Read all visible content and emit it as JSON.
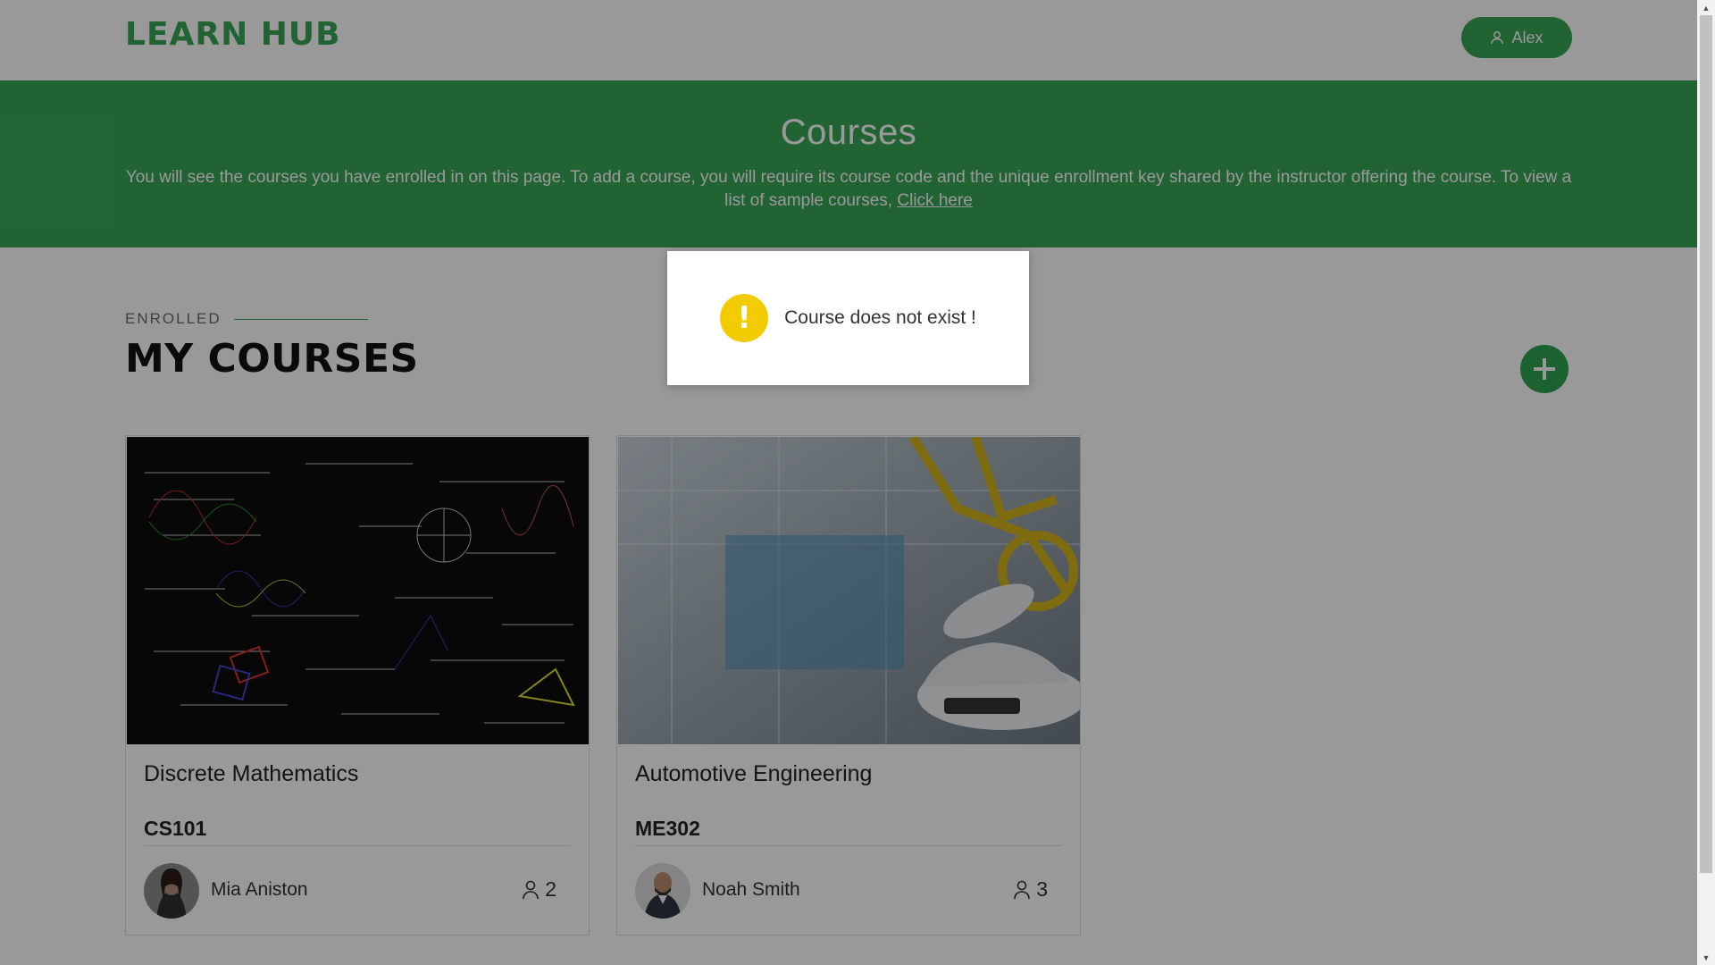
{
  "header": {
    "logo": "LEARN HUB",
    "user_name": "Alex"
  },
  "hero": {
    "title": "Courses",
    "description": "You will see the courses you have enrolled in on this page. To add a course, you will require its course code and the unique enrollment key shared by the instructor offering the course. To view a list of sample courses,",
    "link_text": "Click here"
  },
  "section": {
    "label": "ENROLLED",
    "title": "MY COURSES"
  },
  "courses": [
    {
      "title": "Discrete Mathematics",
      "code": "CS101",
      "instructor": "Mia Aniston",
      "students": "2"
    },
    {
      "title": "Automotive Engineering",
      "code": "ME302",
      "instructor": "Noah Smith",
      "students": "3"
    }
  ],
  "toast": {
    "icon": "!",
    "message": "Course does not exist !"
  },
  "colors": {
    "brand_green": "#3aa657",
    "warning_yellow": "#f2cc00"
  },
  "icons": {
    "user": "user-icon",
    "add": "plus-icon",
    "warning": "warning-icon"
  }
}
